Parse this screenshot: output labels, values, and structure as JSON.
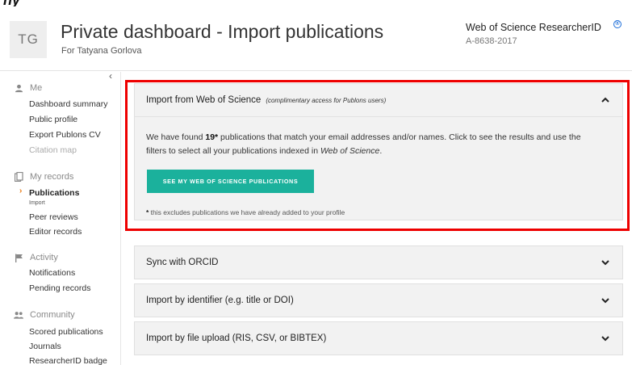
{
  "header": {
    "fragment": "ny",
    "avatar_initials": "TG",
    "title": "Private dashboard - Import publications",
    "subtitle": "For Tatyana Gorlova",
    "researcher_id_title": "Web of Science ResearcherID",
    "researcher_id": "A-8638-2017"
  },
  "sidebar": {
    "sections": [
      {
        "label": "Me",
        "icon": "person-icon",
        "items": [
          "Dashboard summary",
          "Public profile",
          "Export Publons CV",
          "Citation map"
        ]
      },
      {
        "label": "My records",
        "icon": "records-icon",
        "items": [
          "Publications",
          "Peer reviews",
          "Editor records"
        ],
        "active_item": "Publications",
        "active_sub": "Import"
      },
      {
        "label": "Activity",
        "icon": "flag-icon",
        "items": [
          "Notifications",
          "Pending records"
        ]
      },
      {
        "label": "Community",
        "icon": "group-icon",
        "items": [
          "Scored publications",
          "Journals",
          "ResearcherID badge"
        ]
      }
    ]
  },
  "panels": {
    "wos": {
      "title": "Import from Web of Science",
      "note": "(complimentary access for Publons users)",
      "text_before": "We have found ",
      "count": "19*",
      "text_after": " publications that match your email addresses and/or names. Click to see the results and use the filters to select all your publications indexed in ",
      "text_italic": "Web of Science",
      "text_end": ".",
      "button": "SEE MY WEB OF SCIENCE PUBLICATIONS",
      "footnote_star": "*",
      "footnote": " this excludes publications we have already added to your profile"
    },
    "orcid": {
      "title": "Sync with ORCID"
    },
    "identifier": {
      "title": "Import by identifier (e.g. title or DOI)"
    },
    "file": {
      "title": "Import by file upload (RIS, CSV, or BIBTEX)"
    }
  },
  "colors": {
    "accent": "#1bb19c",
    "highlight": "#ee0000",
    "marker": "#e8750a",
    "link": "#1e6fd9"
  }
}
